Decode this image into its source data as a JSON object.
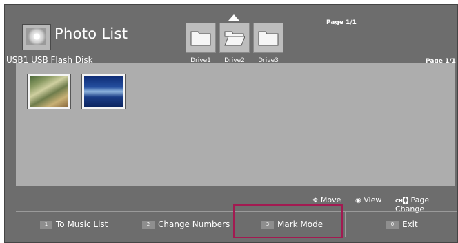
{
  "header": {
    "title": "Photo List",
    "device": "USB1 USB Flash Disk",
    "page_top": "Page 1/1",
    "page_right": "Page 1/1"
  },
  "drives": [
    {
      "label": "Drive1"
    },
    {
      "label": "Drive2",
      "selected": true
    },
    {
      "label": "Drive3"
    }
  ],
  "thumbnails": [
    {
      "icon": "photo-forest"
    },
    {
      "icon": "photo-waves"
    }
  ],
  "legend": {
    "move": "Move",
    "view": "View",
    "ch_key": "CH",
    "page_change": "Page Change"
  },
  "footer": {
    "buttons": [
      {
        "key": "1",
        "label": "To Music List"
      },
      {
        "key": "2",
        "label": "Change Numbers"
      },
      {
        "key": "3",
        "label": "Mark Mode"
      },
      {
        "key": "0",
        "label": "Exit"
      }
    ]
  },
  "colors": {
    "background": "#6d6d6d",
    "content_area": "#adadad",
    "highlight": "#a21a51"
  }
}
